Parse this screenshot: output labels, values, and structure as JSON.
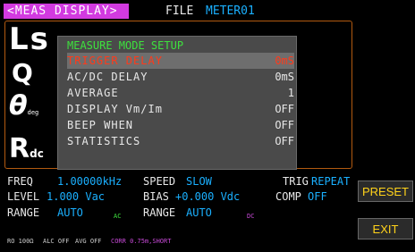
{
  "header": {
    "mode_tag": "<MEAS DISPLAY>",
    "file_label": "FILE",
    "file_name": "METER01"
  },
  "left_params": {
    "p1": "Ls",
    "p2": "Q",
    "p3_symbol": "θ",
    "p3_sub": "deg",
    "p4": "R",
    "p4_sub": "dc"
  },
  "dialog": {
    "title": "MEASURE MODE SETUP",
    "rows": [
      {
        "label": "TRIGGER DELAY",
        "value": "0mS",
        "selected": true
      },
      {
        "label": "AC/DC DELAY",
        "value": "0mS"
      },
      {
        "label": "AVERAGE",
        "value": "1"
      },
      {
        "label": "DISPLAY Vm/Im",
        "value": "OFF"
      },
      {
        "label": "BEEP WHEN",
        "value": "OFF"
      },
      {
        "label": "STATISTICS",
        "value": "OFF"
      }
    ]
  },
  "bottom": {
    "freq_label": "FREQ",
    "freq_value": "1.00000kHz",
    "speed_label": "SPEED",
    "speed_value": "SLOW",
    "trig_label": "TRIG",
    "trig_value": "REPEAT",
    "level_label": "LEVEL",
    "level_value": "1.000 Vac",
    "bias_label": "BIAS",
    "bias_value": "+0.000 Vdc",
    "comp_label": "COMP",
    "comp_value": "OFF",
    "range_label": "RANGE",
    "range_value": "AUTO",
    "range_tag": "AC",
    "range2_label": "RANGE",
    "range2_value": "AUTO",
    "range2_tag": "DC"
  },
  "status": {
    "ro": "RO 100Ω",
    "alc": "ALC OFF",
    "avg": "AVG OFF",
    "corr": "CORR 0.75m,SHORT"
  },
  "softkeys": {
    "preset": "PRESET",
    "exit": "EXIT"
  }
}
